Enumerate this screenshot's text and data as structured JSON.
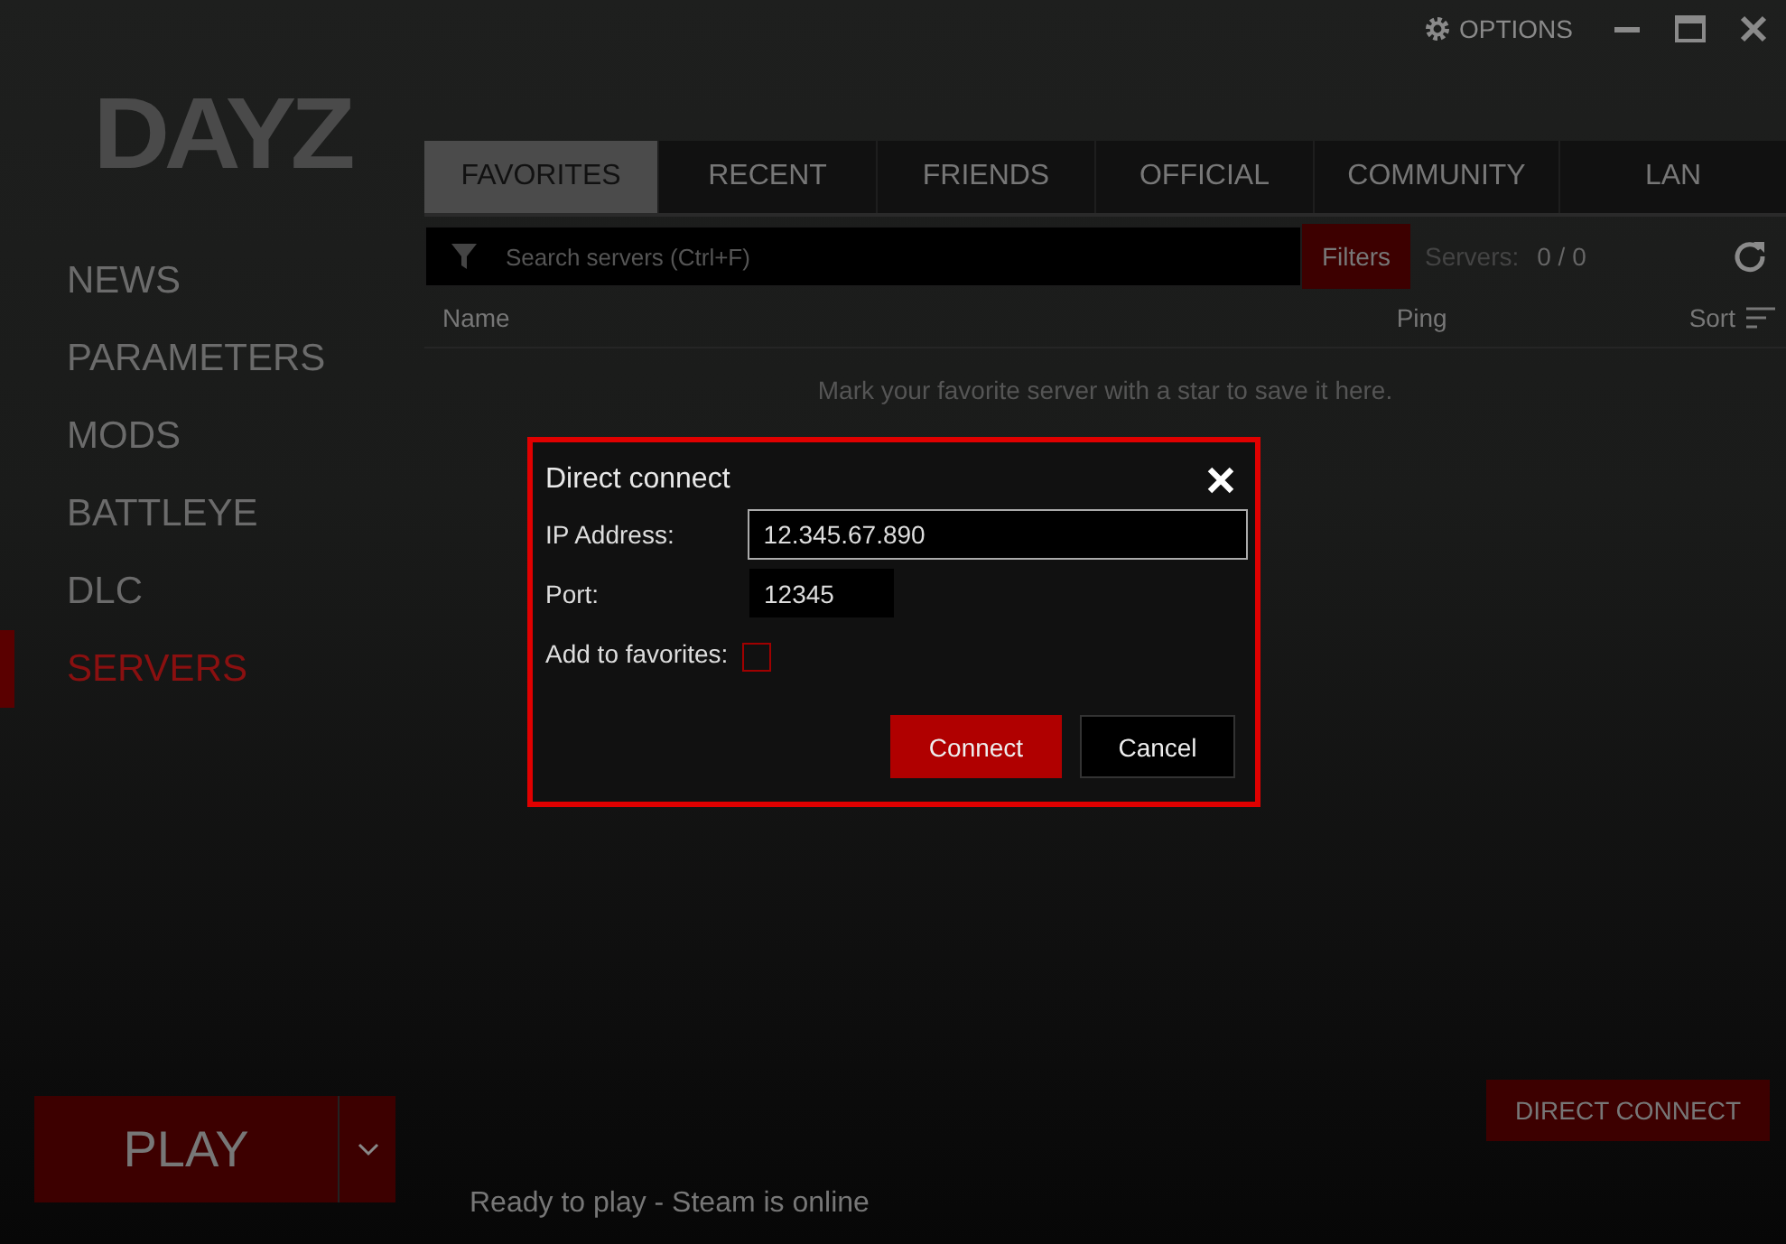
{
  "logo": "DAYZ",
  "window_controls": {
    "options": "OPTIONS"
  },
  "sidebar": {
    "items": [
      {
        "label": "NEWS",
        "selected": false
      },
      {
        "label": "PARAMETERS",
        "selected": false
      },
      {
        "label": "MODS",
        "selected": false
      },
      {
        "label": "BATTLEYE",
        "selected": false
      },
      {
        "label": "DLC",
        "selected": false
      },
      {
        "label": "SERVERS",
        "selected": true
      }
    ]
  },
  "tabs": [
    {
      "label": "FAVORITES",
      "selected": true
    },
    {
      "label": "RECENT",
      "selected": false
    },
    {
      "label": "FRIENDS",
      "selected": false
    },
    {
      "label": "OFFICIAL",
      "selected": false
    },
    {
      "label": "COMMUNITY",
      "selected": false
    },
    {
      "label": "LAN",
      "selected": false
    }
  ],
  "search": {
    "placeholder": "Search servers (Ctrl+F)",
    "filters": "Filters",
    "servers_label": "Servers:",
    "servers_count": "0 / 0"
  },
  "table": {
    "columns": [
      "Name",
      "Ping"
    ],
    "sort": "Sort",
    "empty_message": "Mark your favorite server with a star to save it here."
  },
  "dialog": {
    "title": "Direct connect",
    "ip_label": "IP Address:",
    "ip_value": "12.345.67.890",
    "port_label": "Port:",
    "port_value": "12345",
    "favorites_label": "Add to favorites:",
    "favorites_checked": false,
    "buttons": [
      "Connect",
      "Cancel"
    ]
  },
  "play_button": "PLAY",
  "direct_connect_button": "DIRECT CONNECT",
  "status_bar": "Ready to play - Steam is online"
}
